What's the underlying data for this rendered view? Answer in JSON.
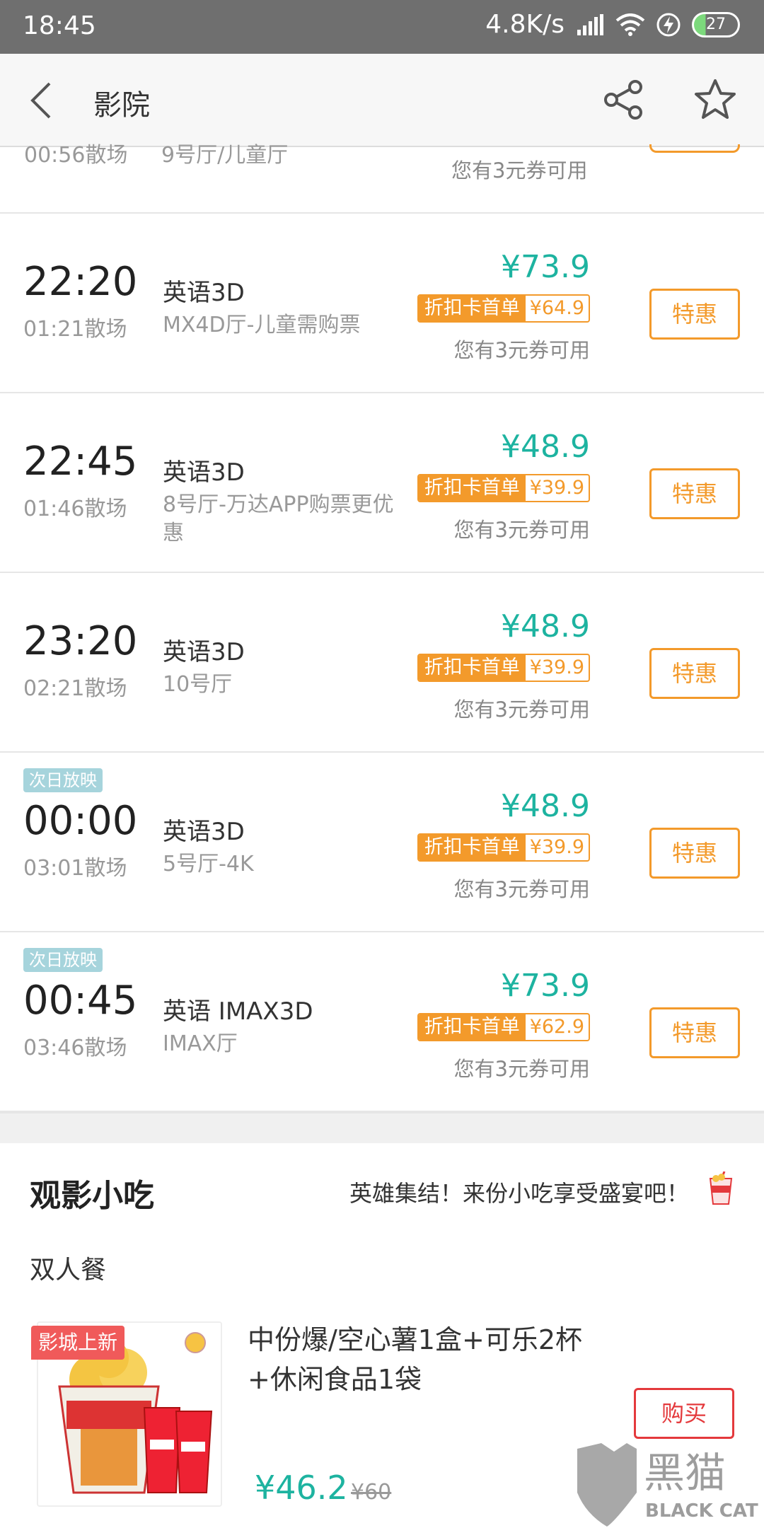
{
  "status": {
    "time": "18:45",
    "speed": "4.8K/s",
    "battery": "27"
  },
  "nav": {
    "title": "影院"
  },
  "prev_tail": {
    "end": "00:56散场",
    "hall": "9号厅/儿童厅",
    "coupon": "您有3元券可用"
  },
  "showtimes": [
    {
      "time": "22:20",
      "end": "01:21散场",
      "lang": "英语3D",
      "hall": "MX4D厅-儿童需购票",
      "price": "¥73.9",
      "promo_label": "折扣卡首单",
      "promo_price": "¥64.9",
      "coupon": "您有3元券可用",
      "button": "特惠",
      "tag": ""
    },
    {
      "time": "22:45",
      "end": "01:46散场",
      "lang": "英语3D",
      "hall": "8号厅-万达APP购票更优惠",
      "price": "¥48.9",
      "promo_label": "折扣卡首单",
      "promo_price": "¥39.9",
      "coupon": "您有3元券可用",
      "button": "特惠",
      "tag": ""
    },
    {
      "time": "23:20",
      "end": "02:21散场",
      "lang": "英语3D",
      "hall": "10号厅",
      "price": "¥48.9",
      "promo_label": "折扣卡首单",
      "promo_price": "¥39.9",
      "coupon": "您有3元券可用",
      "button": "特惠",
      "tag": ""
    },
    {
      "time": "00:00",
      "end": "03:01散场",
      "lang": "英语3D",
      "hall": "5号厅-4K",
      "price": "¥48.9",
      "promo_label": "折扣卡首单",
      "promo_price": "¥39.9",
      "coupon": "您有3元券可用",
      "button": "特惠",
      "tag": "次日放映"
    },
    {
      "time": "00:45",
      "end": "03:46散场",
      "lang": "英语 IMAX3D",
      "hall": "IMAX厅",
      "price": "¥73.9",
      "promo_label": "折扣卡首单",
      "promo_price": "¥62.9",
      "coupon": "您有3元券可用",
      "button": "特惠",
      "tag": "次日放映"
    }
  ],
  "snacks": {
    "title": "观影小吃",
    "slogan": "英雄集结！来份小吃享受盛宴吧！",
    "category": "双人餐",
    "new_tag": "影城上新",
    "product_name": "中份爆/空心薯1盒+可乐2杯+休闲食品1袋",
    "price": "¥46.2",
    "original_price": "¥60",
    "buy": "购买"
  },
  "watermark": {
    "text": "黑猫",
    "sub": "BLACK CAT"
  },
  "colors": {
    "accent_teal": "#1db3a0",
    "accent_orange": "#f39a2b",
    "buy_red": "#e4393c",
    "statusbar": "#6f6f6f"
  }
}
